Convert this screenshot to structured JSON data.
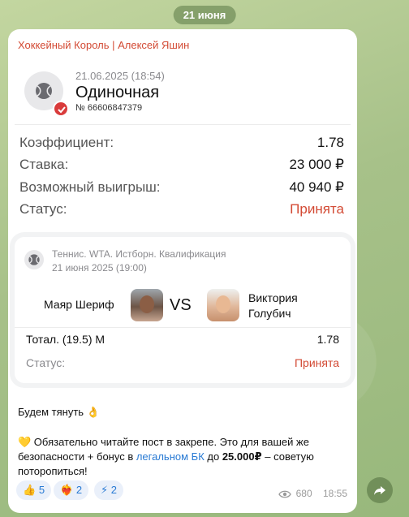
{
  "date_pill": "21 июня",
  "post": {
    "sender": "Хоккейный Король | Алексей Яшин",
    "bet": {
      "datetime": "21.06.2025 (18:54)",
      "type": "Одиночная",
      "number": "№ 66606847379",
      "rows": [
        {
          "label": "Коэффициент:",
          "value": "1.78"
        },
        {
          "label": "Ставка:",
          "value": "23 000 ₽"
        },
        {
          "label": "Возможный выигрыш:",
          "value": "40 940 ₽"
        },
        {
          "label": "Статус:",
          "value": "Принята"
        }
      ]
    },
    "event": {
      "league": "Теннис. WTA. Истборн. Квалификация",
      "date": "21 июня 2025 (19:00)",
      "player1": "Маяр Шериф",
      "vs": "VS",
      "player2_line1": "Виктория",
      "player2_line2": "Голубич",
      "pick": "Тотал. (19.5) М",
      "odds": "1.78",
      "status_label": "Статус:",
      "status": "Принята"
    },
    "text": {
      "line1": "Будем тянуть",
      "line1_emoji": "👌",
      "heart_emoji": "💛",
      "para_part1": " Обязательно читайте пост в закрепе. Это для вашей же безопасности + бонус в ",
      "link": "легальном БК",
      "para_part2": " до ",
      "bonus": "25.000₽",
      "para_part3": " – советую поторопиться!"
    },
    "reactions": [
      {
        "emoji": "👍",
        "count": "5"
      },
      {
        "emoji": "❤️‍🔥",
        "count": "2"
      },
      {
        "emoji": "⚡",
        "count": "2"
      }
    ],
    "views": "680",
    "time": "18:55"
  },
  "colors": {
    "accent_red": "#d34a34",
    "link_blue": "#2a7bd4"
  }
}
